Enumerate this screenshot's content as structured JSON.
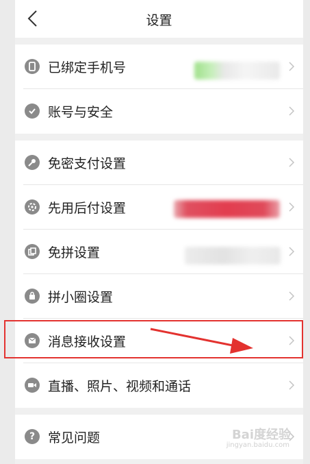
{
  "header": {
    "title": "设置"
  },
  "groups": [
    {
      "items": [
        {
          "label": "已绑定手机号",
          "icon": "phone-icon"
        },
        {
          "label": "账号与安全",
          "icon": "shield-icon"
        }
      ]
    },
    {
      "items": [
        {
          "label": "免密支付设置",
          "icon": "key-icon"
        },
        {
          "label": "先用后付设置",
          "icon": "gear-icon"
        },
        {
          "label": "免拼设置",
          "icon": "copy-icon"
        },
        {
          "label": "拼小圈设置",
          "icon": "bag-icon"
        },
        {
          "label": "消息接收设置",
          "icon": "mail-icon"
        },
        {
          "label": "直播、照片、视频和通话",
          "icon": "video-icon"
        }
      ]
    },
    {
      "items": [
        {
          "label": "常见问题",
          "icon": "question-icon"
        }
      ]
    }
  ],
  "watermark": {
    "main": "Bai度经验",
    "sub": "jingyan.baidu.com"
  },
  "colors": {
    "annotation": "#e3322f",
    "icon": "#8a8a8a"
  }
}
